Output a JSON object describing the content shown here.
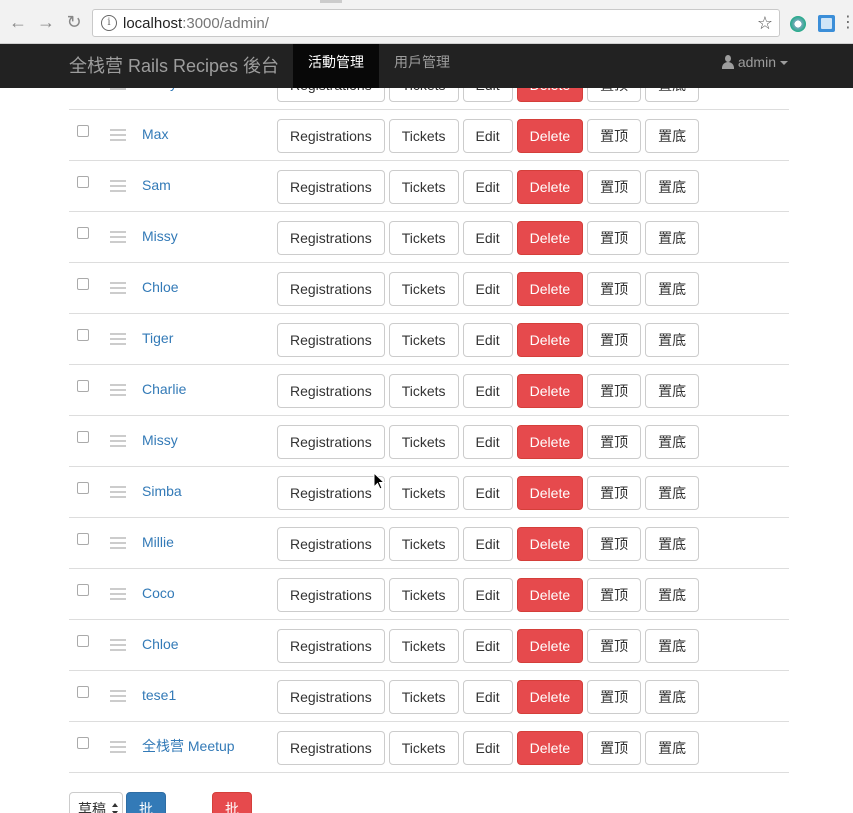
{
  "browser": {
    "url_host": "localhost",
    "url_rest": ":3000/admin/"
  },
  "navbar": {
    "brand": "全栈营 Rails Recipes 後台",
    "tabs": [
      {
        "label": "活動管理",
        "active": true
      },
      {
        "label": "用戶管理",
        "active": false
      }
    ],
    "user": "admin"
  },
  "row_actions": {
    "registrations": "Registrations",
    "tickets": "Tickets",
    "edit": "Edit",
    "delete": "Delete",
    "top": "置顶",
    "bottom": "置底"
  },
  "events": [
    {
      "name": "Daisy"
    },
    {
      "name": "Max"
    },
    {
      "name": "Sam"
    },
    {
      "name": "Missy"
    },
    {
      "name": "Chloe"
    },
    {
      "name": "Tiger"
    },
    {
      "name": "Charlie"
    },
    {
      "name": "Missy"
    },
    {
      "name": "Simba"
    },
    {
      "name": "Millie"
    },
    {
      "name": "Coco"
    },
    {
      "name": "Chloe"
    },
    {
      "name": "tese1"
    },
    {
      "name": "全栈营 Meetup"
    }
  ],
  "bulk": {
    "status_select": "草稿",
    "edit_button": "批次編輯",
    "delete_button": "批次刪除"
  },
  "colors": {
    "danger": "#e64a4d",
    "primary": "#337ab7",
    "navbar": "#222222"
  }
}
